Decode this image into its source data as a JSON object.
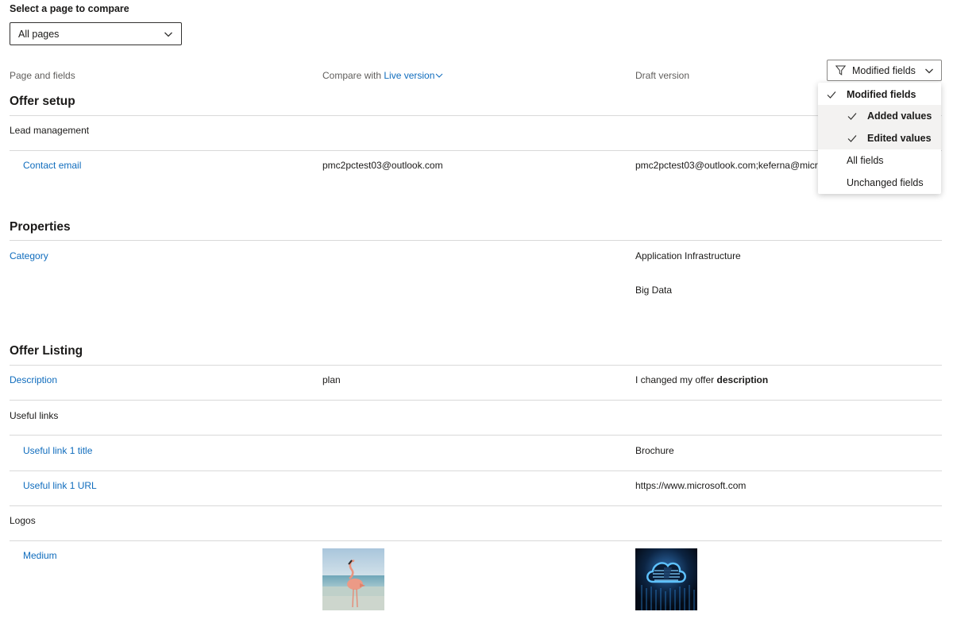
{
  "selector": {
    "label": "Select a page to compare",
    "value": "All pages"
  },
  "columns": {
    "page_fields": "Page and fields",
    "compare_prefix": "Compare with",
    "compare_link": "Live version",
    "draft": "Draft version"
  },
  "filter": {
    "button_label": "Modified fields",
    "menu": {
      "modified": "Modified fields",
      "added": "Added values",
      "edited": "Edited values",
      "all": "All fields",
      "unchanged": "Unchanged fields"
    }
  },
  "sections": {
    "offer_setup": {
      "title": "Offer setup",
      "group": "Lead management",
      "contact_email": {
        "label": "Contact email",
        "live": "pmc2pctest03@outlook.com",
        "draft": "pmc2pctest03@outlook.com;keferna@micr"
      }
    },
    "properties": {
      "title": "Properties",
      "category": {
        "label": "Category",
        "draft_1": "Application Infrastructure",
        "draft_2": "Big Data"
      }
    },
    "offer_listing": {
      "title": "Offer Listing",
      "description": {
        "label": "Description",
        "live": "plan",
        "draft_prefix": "I changed my offer ",
        "draft_bold": "description"
      },
      "useful_links": "Useful links",
      "link1_title": {
        "label": "Useful link 1 title",
        "draft": "Brochure"
      },
      "link1_url": {
        "label": "Useful link 1 URL",
        "draft": "https://www.microsoft.com"
      },
      "logos": "Logos",
      "medium": {
        "label": "Medium"
      }
    }
  },
  "colors": {
    "link": "#0f6cbd",
    "divider": "#d9d9d9",
    "hover_row": "#f3f2f1"
  }
}
